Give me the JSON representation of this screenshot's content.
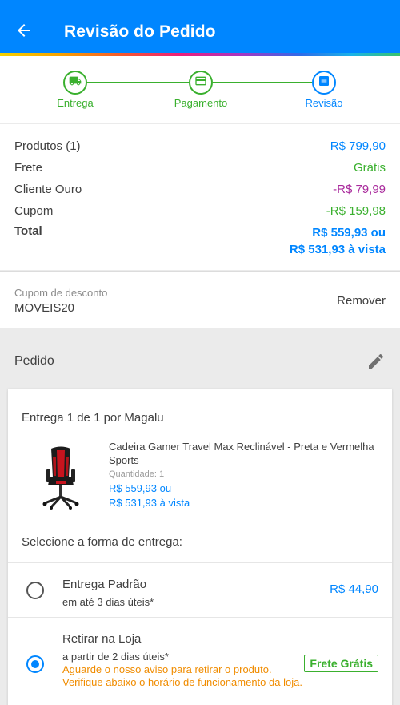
{
  "header": {
    "title": "Revisão do Pedido"
  },
  "steps": [
    {
      "label": "Entrega",
      "icon": "truck-icon",
      "state": "done"
    },
    {
      "label": "Pagamento",
      "icon": "card-icon",
      "state": "done"
    },
    {
      "label": "Revisão",
      "icon": "list-icon",
      "state": "active"
    }
  ],
  "summary": {
    "products_label": "Produtos (1)",
    "products_value": "R$ 799,90",
    "freight_label": "Frete",
    "freight_value": "Grátis",
    "gold_label": "Cliente Ouro",
    "gold_value": "-R$ 79,99",
    "coupon_label": "Cupom",
    "coupon_value": "-R$ 159,98",
    "total_label": "Total",
    "total_value_1": "R$ 559,93 ou",
    "total_value_2": "R$ 531,93 à vista"
  },
  "coupon": {
    "label": "Cupom de desconto",
    "code": "MOVEIS20",
    "remove": "Remover"
  },
  "order": {
    "title": "Pedido",
    "delivery_title": "Entrega 1 de 1 por Magalu",
    "product": {
      "name": "Cadeira Gamer Travel Max Reclinável - Preta e Vermelha Sports",
      "quantity": "Quantidade:  1",
      "price_1": "R$ 559,93 ou",
      "price_2": "R$ 531,93 à vista"
    },
    "select_title": "Selecione a forma de entrega:",
    "options": [
      {
        "name": "Entrega Padrão",
        "sub": "em até 3 dias úteis*",
        "price": "R$ 44,90",
        "selected": false
      },
      {
        "name": "Retirar na Loja",
        "sub": "a partir de 2 dias úteis*",
        "note": "Aguarde o nosso aviso para retirar o produto. Verifique abaixo o horário de funcionamento da loja.",
        "badge": "Frete Grátis",
        "selected": true
      }
    ]
  },
  "colors": {
    "primary": "#0086ff",
    "green": "#3ab02e",
    "purple": "#a92a9c",
    "orange": "#f08c00"
  }
}
